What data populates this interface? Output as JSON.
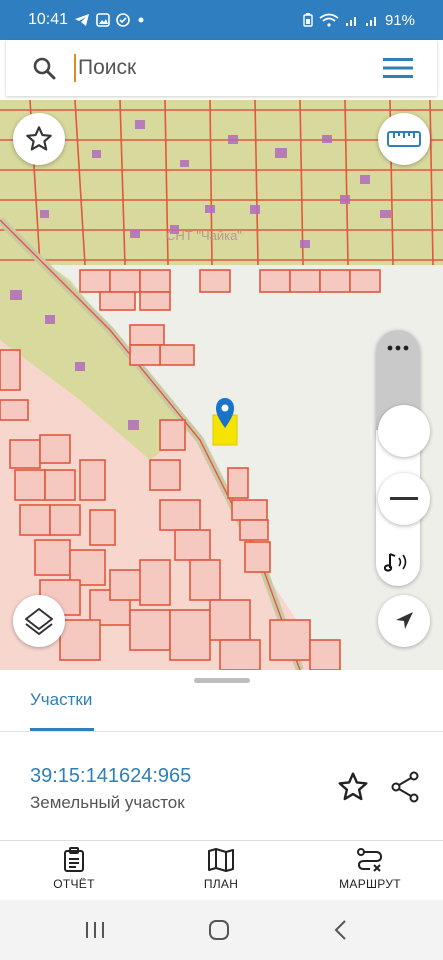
{
  "status": {
    "time": "10:41",
    "battery": "91%",
    "notification_icons": [
      "telegram-icon",
      "gallery-icon",
      "check-icon",
      "dot-icon"
    ],
    "system_icons": [
      "battery-saver-icon",
      "wifi-icon",
      "signal-icon",
      "signal-icon"
    ]
  },
  "search": {
    "placeholder": "Поиск"
  },
  "map": {
    "snt_label": "СНТ \"Чайка\"",
    "marker_color": "#1a73c9",
    "parcel_highlight_color": "#f5e400"
  },
  "sheet": {
    "tab_label": "Участки",
    "parcel_id": "39:15:141624:965",
    "parcel_type": "Земельный участок"
  },
  "bottom_nav": {
    "report": "ОТЧЁТ",
    "plan": "ПЛАН",
    "route": "МАРШРУТ"
  },
  "colors": {
    "accent": "#2f7fb8",
    "status_bar": "#2f7fc0",
    "parcel_border": "#e3573e",
    "parcel_fill": "#f6c9c0",
    "garden_fill": "#d8d99c",
    "building_fill": "#b36bc0"
  }
}
